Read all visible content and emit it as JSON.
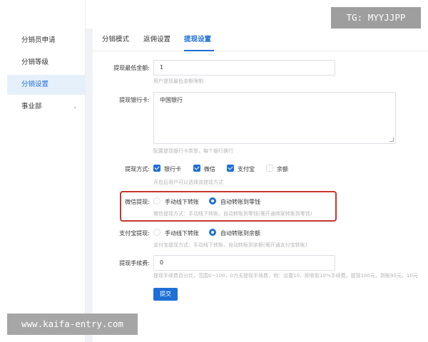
{
  "sidebar": {
    "items": [
      {
        "label": "分销员申请"
      },
      {
        "label": "分销等级"
      },
      {
        "label": "分销设置"
      },
      {
        "label": "事业部"
      }
    ]
  },
  "tabs": [
    {
      "label": "分销模式"
    },
    {
      "label": "返佣设置"
    },
    {
      "label": "提现设置"
    }
  ],
  "form": {
    "min_amount": {
      "label": "提现最低金额:",
      "value": "1",
      "hint": "用户提现最低金额限制"
    },
    "bank_card": {
      "label": "提现银行卡:",
      "value": "中国银行",
      "hint": "配置提现银行卡类型，每个银行换行"
    },
    "methods": {
      "label": "提现方式:",
      "options": [
        {
          "label": "银行卡",
          "checked": true
        },
        {
          "label": "微信",
          "checked": true
        },
        {
          "label": "支付宝",
          "checked": true
        },
        {
          "label": "余额",
          "checked": false
        }
      ],
      "hint": "开启后用户可以选择该提现方式"
    },
    "wechat": {
      "label": "微信提现:",
      "options": [
        {
          "label": "手动线下转账",
          "selected": false
        },
        {
          "label": "自动转账到零钱",
          "selected": true
        }
      ],
      "hint": "微信提现方式：手动线下转账、自动转账到零钱(需开通商家转账到零钱)"
    },
    "alipay": {
      "label": "支付宝提现:",
      "options": [
        {
          "label": "手动线下转账",
          "selected": false
        },
        {
          "label": "自动转账到余额",
          "selected": true
        }
      ],
      "hint": "支付宝提现方式：手动线下转账、自动转账到余额(需开通支付宝转账)"
    },
    "fee": {
      "label": "提现手续费:",
      "value": "0",
      "hint": "提现手续费百分比，范围0~100，0为无提现手续费，例：设置10，即收取10%手续费，提现100元，到账90元，10元"
    },
    "submit_label": "提交"
  },
  "watermarks": {
    "tag": "TG: MYYJJPP",
    "url": "www.kaifa-entry.com"
  },
  "colors": {
    "accent": "#1f6fd6",
    "highlight_border": "#c8362f",
    "sidebar_active_bg": "#e6f0fb"
  }
}
